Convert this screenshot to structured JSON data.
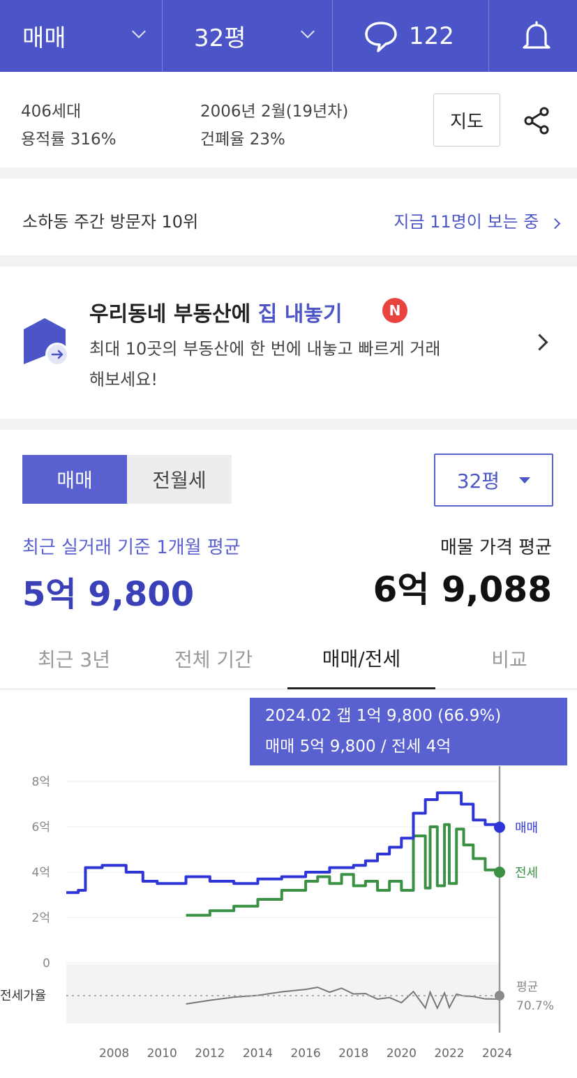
{
  "topbar": {
    "trade_type": "매매",
    "area": "32평",
    "comment_count": "122"
  },
  "info": {
    "households": "406세대",
    "floor_area_ratio": "용적률 316%",
    "built": "2006년 2월(19년차)",
    "building_coverage": "건폐율 23%",
    "map_button": "지도"
  },
  "visitor": {
    "rank": "소하동 주간 방문자 10위",
    "watching": "지금 11명이 보는 중"
  },
  "promo": {
    "title_prefix": "우리동네 부동산에 ",
    "title_highlight": "집 내놓기",
    "badge": "N",
    "desc": "최대 10곳의 부동산에 한 번에 내놓고 빠르게 거래해보세요!"
  },
  "trade_toggle": {
    "sale": "매매",
    "rent": "전월세"
  },
  "size_select": {
    "value": "32평"
  },
  "summary": {
    "recent_label": "최근 실거래 기준 1개월 평균",
    "recent_value": "5억 9,800",
    "listing_label": "매물 가격 평균",
    "listing_value": "6억 9,088"
  },
  "tabs": [
    "최근 3년",
    "전체 기간",
    "매매/전세",
    "비교"
  ],
  "tooltip": {
    "line1": "2024.02  갭 1억 9,800 (66.9%)",
    "line2": "매매 5억 9,800 / 전세 4억"
  },
  "colors": {
    "brand": "#4c55c7",
    "sale_line": "#2f34d6",
    "jeonse_line": "#3a9144",
    "ratio_line": "#777777"
  },
  "icons": [
    "chat-bubble-icon",
    "bell-icon",
    "share-icon",
    "house-upload-icon",
    "chevron-right-icon"
  ],
  "chart_data": {
    "type": "line",
    "ylim": [
      0,
      8
    ],
    "y_ticks": [
      "8억",
      "6억",
      "4억",
      "2억",
      "0"
    ],
    "x_ticks": [
      "2008",
      "2010",
      "2012",
      "2014",
      "2016",
      "2018",
      "2020",
      "2022",
      "2024"
    ],
    "ratio_label": "전세가율",
    "ratio_avg_label": "평균",
    "ratio_avg_value": "70.7%",
    "series": [
      {
        "name": "매매",
        "x": [
          2006.0,
          2006.5,
          2006.8,
          2007.5,
          2008.5,
          2009.2,
          2009.8,
          2010.5,
          2011.0,
          2012.0,
          2013.0,
          2014.0,
          2015.0,
          2016.0,
          2017.0,
          2018.0,
          2018.5,
          2019.0,
          2019.5,
          2020.0,
          2020.5,
          2021.0,
          2021.5,
          2022.0,
          2022.5,
          2023.0,
          2023.5,
          2024.1
        ],
        "values": [
          3.1,
          3.2,
          4.2,
          4.3,
          4.0,
          3.6,
          3.5,
          3.5,
          3.8,
          3.6,
          3.5,
          3.7,
          3.8,
          4.0,
          4.2,
          4.3,
          4.5,
          4.8,
          5.1,
          5.5,
          6.6,
          7.2,
          7.5,
          7.5,
          7.0,
          6.3,
          6.1,
          5.98
        ]
      },
      {
        "name": "전세",
        "x": [
          2011.0,
          2012.0,
          2013.0,
          2014.0,
          2015.0,
          2016.0,
          2016.5,
          2017.0,
          2017.5,
          2018.0,
          2018.5,
          2019.0,
          2019.5,
          2020.0,
          2020.5,
          2021.0,
          2021.2,
          2021.5,
          2021.8,
          2022.0,
          2022.3,
          2022.6,
          2023.0,
          2023.5,
          2024.1
        ],
        "values": [
          2.1,
          2.3,
          2.5,
          2.8,
          3.2,
          3.6,
          3.8,
          3.5,
          3.9,
          3.4,
          3.6,
          3.2,
          3.6,
          3.2,
          5.6,
          3.3,
          6.0,
          3.4,
          6.1,
          3.5,
          5.9,
          5.2,
          4.6,
          4.1,
          4.0
        ]
      }
    ]
  }
}
